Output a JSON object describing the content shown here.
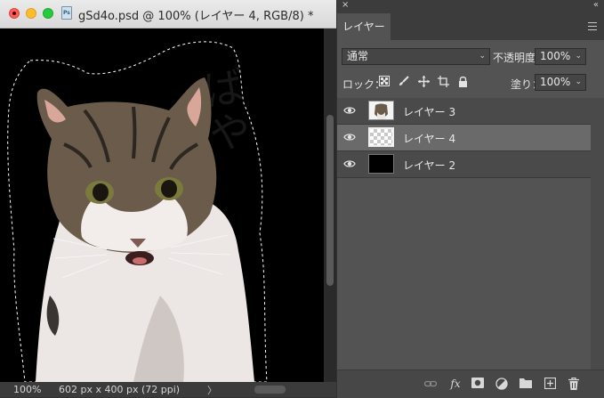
{
  "document": {
    "title": "gSd4o.psd @ 100% (レイヤー 4, RGB/8) *",
    "watermark_text": "ばや",
    "zoom": "100%",
    "info": "602 px x 400 px (72 ppi)",
    "status_arrow": "〉"
  },
  "panel": {
    "close_label": "×",
    "collapse_label": "«",
    "tab_label": "レイヤー",
    "blend_mode": "通常",
    "opacity_label": "不透明度：",
    "opacity_value": "100%",
    "lock_label": "ロック：",
    "fill_label": "塗り：",
    "fill_value": "100%",
    "lock_icons": [
      "lock-transparent-pixels-icon",
      "lock-image-pixels-icon",
      "lock-position-icon",
      "artboard-nesting-icon",
      "lock-all-icon"
    ]
  },
  "layers": [
    {
      "name": "レイヤー 3",
      "thumbnail": "cat-photo",
      "visible": true,
      "selected": false
    },
    {
      "name": "レイヤー 4",
      "thumbnail": "transparent",
      "visible": true,
      "selected": true
    },
    {
      "name": "レイヤー 2",
      "thumbnail": "black",
      "visible": true,
      "selected": false
    }
  ],
  "bottom_icons": [
    "link-layers-icon",
    "fx-icon",
    "add-mask-icon",
    "adjustment-layer-icon",
    "new-group-icon",
    "new-layer-icon",
    "delete-layer-icon"
  ],
  "colors": {
    "panel_bg": "#535353",
    "selected_layer": "#6a6a6a",
    "canvas_bg": "#000000",
    "close_red": "#fe5f57",
    "minimize_yellow": "#febc2e",
    "zoom_green": "#28c840"
  }
}
